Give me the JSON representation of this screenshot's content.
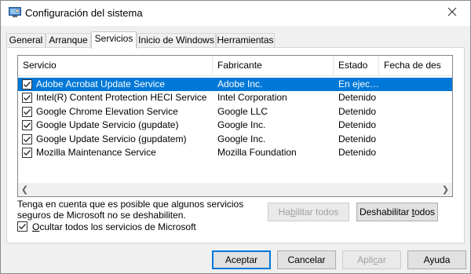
{
  "window": {
    "title": "Configuración del sistema"
  },
  "tabs": [
    {
      "label": "General"
    },
    {
      "label": "Arranque"
    },
    {
      "label": "Servicios"
    },
    {
      "label": "Inicio de Windows"
    },
    {
      "label": "Herramientas"
    }
  ],
  "active_tab": "Servicios",
  "columns": [
    "Servicio",
    "Fabricante",
    "Estado",
    "Fecha de des"
  ],
  "services": [
    {
      "name": "Adobe Acrobat Update Service",
      "vendor": "Adobe Inc.",
      "status": "En ejec…",
      "checked": true,
      "selected": true
    },
    {
      "name": "Intel(R) Content Protection HECI Service",
      "vendor": "Intel Corporation",
      "status": "Detenido",
      "checked": true,
      "selected": false
    },
    {
      "name": "Google Chrome Elevation Service",
      "vendor": "Google LLC",
      "status": "Detenido",
      "checked": true,
      "selected": false
    },
    {
      "name": "Google Update Servicio (gupdate)",
      "vendor": "Google Inc.",
      "status": "Detenido",
      "checked": true,
      "selected": false
    },
    {
      "name": "Google Update Servicio (gupdatem)",
      "vendor": "Google Inc.",
      "status": "Detenido",
      "checked": true,
      "selected": false
    },
    {
      "name": "Mozilla Maintenance Service",
      "vendor": "Mozilla Foundation",
      "status": "Detenido",
      "checked": true,
      "selected": false
    }
  ],
  "note": {
    "line1": "Tenga en cuenta que es posible que algunos servicios",
    "line2": "seguros de Microsoft no se deshabiliten."
  },
  "buttons": {
    "enable_all": {
      "before": "Ha",
      "key": "b",
      "after": "ilitar todos"
    },
    "disable_all": {
      "before": "Deshabilitar ",
      "key": "t",
      "after": "odos"
    },
    "ok": "Aceptar",
    "cancel": "Cancelar",
    "apply": {
      "before": "Apli",
      "key": "c",
      "after": "ar"
    },
    "help": "Ayuda"
  },
  "hide_ms": {
    "key": "O",
    "rest": "cultar todos los servicios de Microsoft",
    "checked": true
  },
  "colors": {
    "selection": "#0078d7",
    "accent": "#0078d7"
  }
}
